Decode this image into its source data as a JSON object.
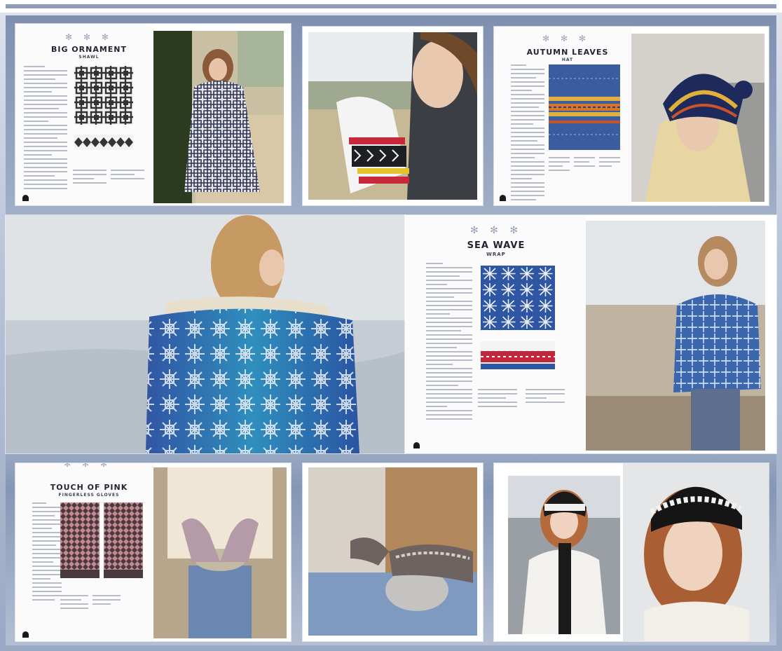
{
  "spreads": [
    {
      "title": "BIG ORNAMENT",
      "subtitle": "SHAWL"
    },
    {
      "title": "AUTUMN LEAVES",
      "subtitle": "HAT"
    },
    {
      "title": "SEA WAVE",
      "subtitle": "WRAP"
    },
    {
      "title": "TOUCH OF PINK",
      "subtitle": "FINGERLESS GLOVES"
    }
  ],
  "ornament": "✻ ✻ ✻",
  "colors": {
    "navy": "#2f3f7f",
    "cream": "#eef0f2",
    "red": "#b8283a",
    "mustard": "#d8a62a",
    "blue": "#3a78b8",
    "pink": "#c48a93"
  }
}
